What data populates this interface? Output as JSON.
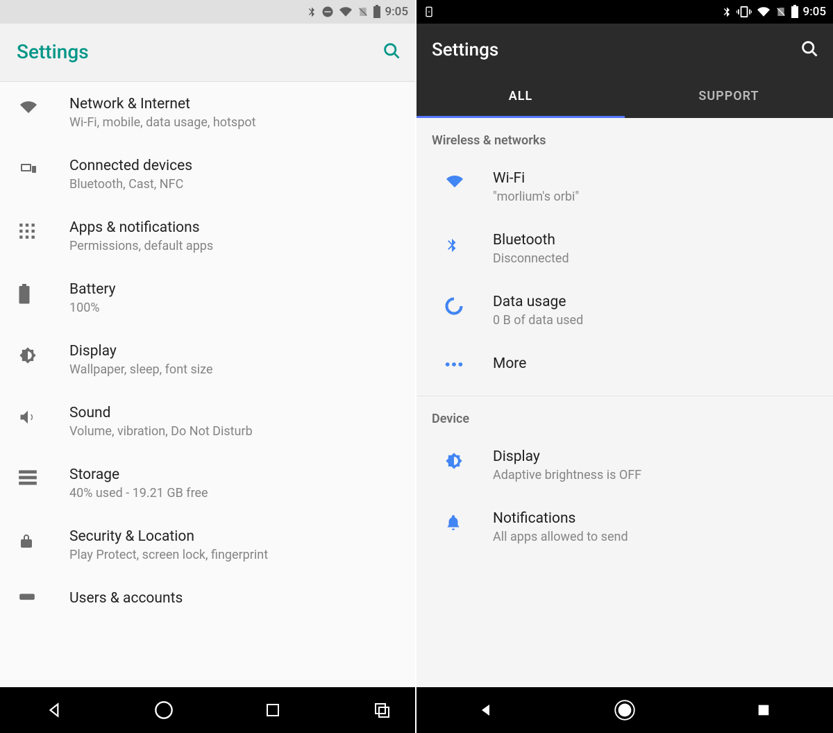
{
  "left": {
    "status_time": "9:05",
    "title": "Settings",
    "items": [
      {
        "icon": "wifi",
        "title": "Network & Internet",
        "sub": "Wi-Fi, mobile, data usage, hotspot"
      },
      {
        "icon": "devices",
        "title": "Connected devices",
        "sub": "Bluetooth, Cast, NFC"
      },
      {
        "icon": "apps",
        "title": "Apps & notifications",
        "sub": "Permissions, default apps"
      },
      {
        "icon": "battery",
        "title": "Battery",
        "sub": "100%"
      },
      {
        "icon": "display",
        "title": "Display",
        "sub": "Wallpaper, sleep, font size"
      },
      {
        "icon": "sound",
        "title": "Sound",
        "sub": "Volume, vibration, Do Not Disturb"
      },
      {
        "icon": "storage",
        "title": "Storage",
        "sub": "40% used - 19.21 GB free"
      },
      {
        "icon": "lock",
        "title": "Security & Location",
        "sub": "Play Protect, screen lock, fingerprint"
      },
      {
        "icon": "users",
        "title": "Users & accounts",
        "sub": ""
      }
    ]
  },
  "right": {
    "status_time": "9:05",
    "title": "Settings",
    "tabs": {
      "active": "ALL",
      "other": "SUPPORT"
    },
    "sections": [
      {
        "head": "Wireless & networks",
        "items": [
          {
            "icon": "wifi",
            "title": "Wi-Fi",
            "sub": "\"morlium's orbi\""
          },
          {
            "icon": "bt",
            "title": "Bluetooth",
            "sub": "Disconnected"
          },
          {
            "icon": "data",
            "title": "Data usage",
            "sub": "0 B of data used"
          },
          {
            "icon": "more",
            "title": "More",
            "sub": ""
          }
        ]
      },
      {
        "head": "Device",
        "items": [
          {
            "icon": "display",
            "title": "Display",
            "sub": "Adaptive brightness is OFF"
          },
          {
            "icon": "bell",
            "title": "Notifications",
            "sub": "All apps allowed to send"
          }
        ]
      }
    ]
  }
}
